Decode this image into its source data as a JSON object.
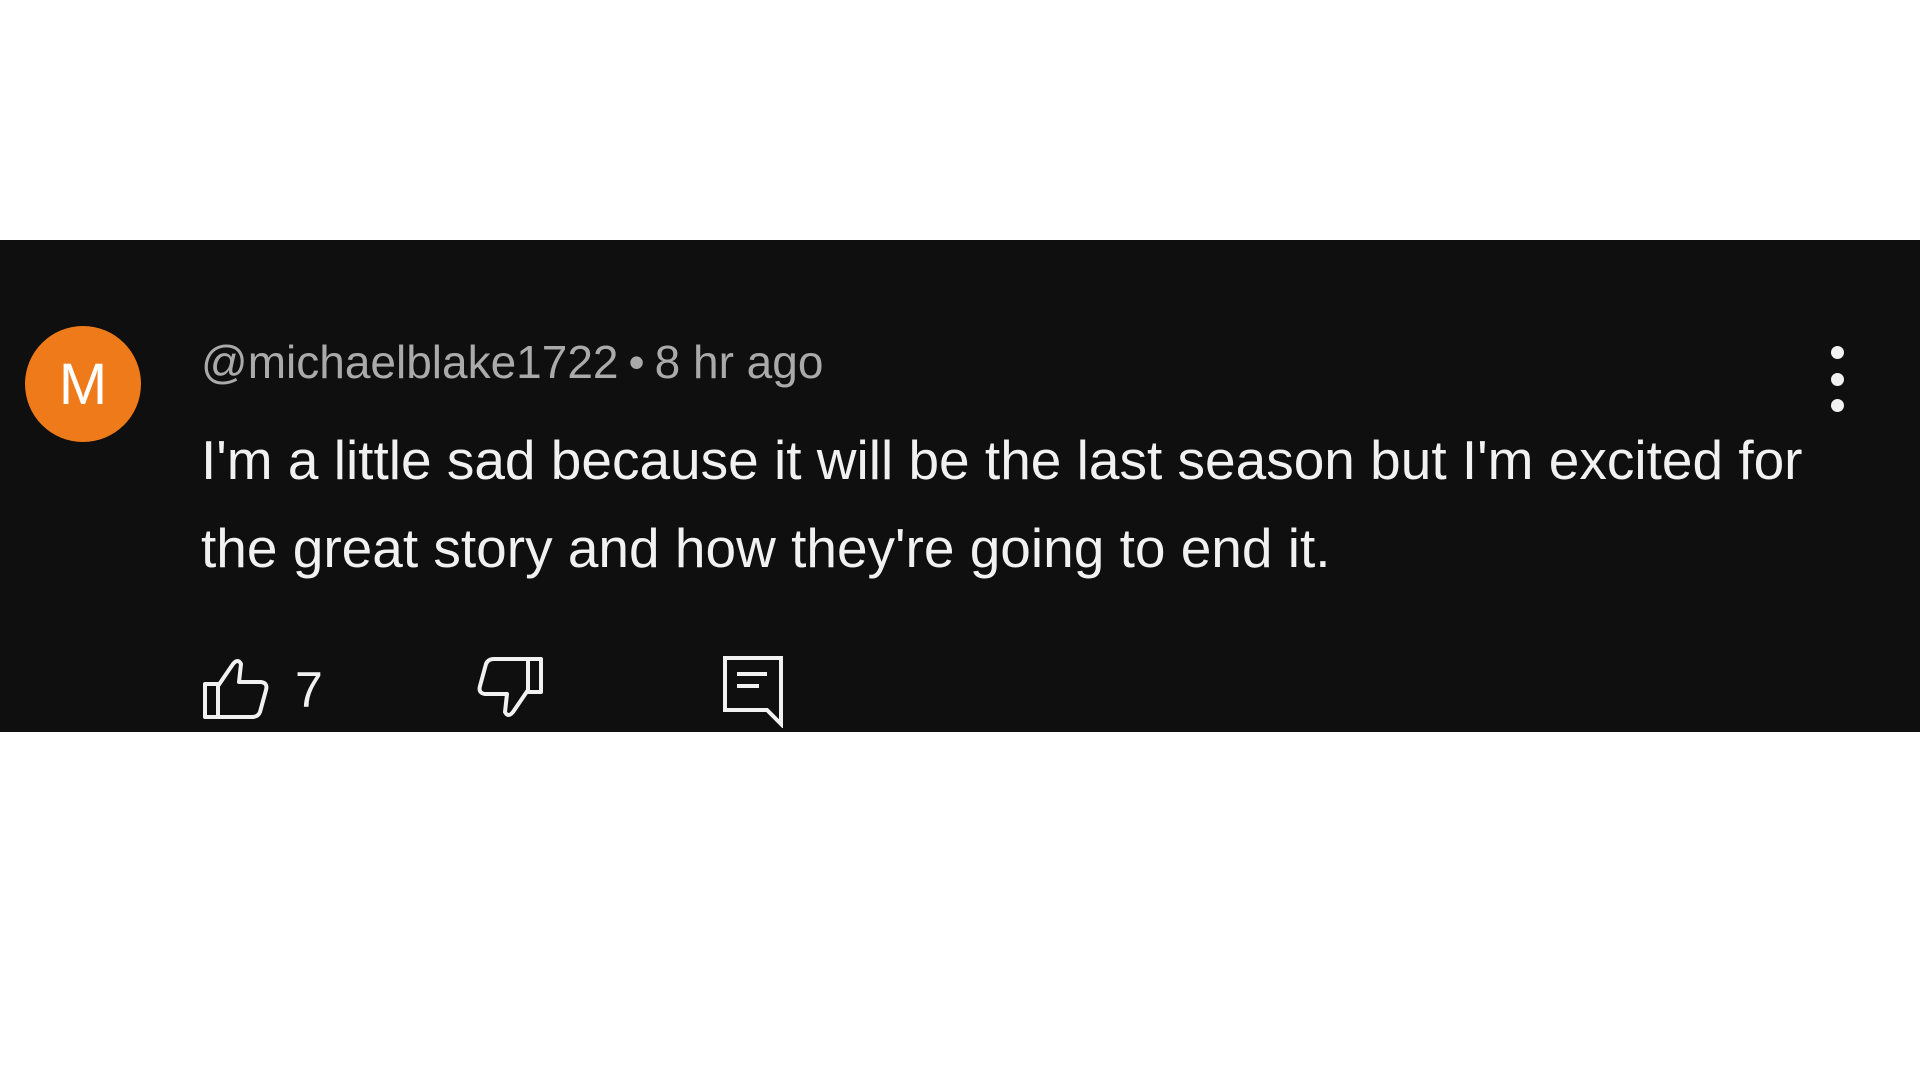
{
  "comment": {
    "avatar_letter": "M",
    "avatar_color": "#ef7a1a",
    "author": "@michaelblake1722",
    "separator": "•",
    "timestamp": "8 hr ago",
    "text": "I'm a little sad because it will be the last season but I'm excited for the great story and how they're going to end it.",
    "like_count": "7",
    "icons": {
      "like": "thumbs-up-icon",
      "dislike": "thumbs-down-icon",
      "reply": "comment-reply-icon",
      "more": "more-vertical-icon"
    }
  }
}
